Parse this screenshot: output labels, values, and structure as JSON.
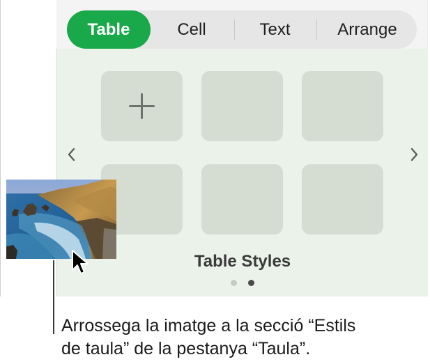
{
  "tabs": [
    {
      "label": "Table",
      "active": true
    },
    {
      "label": "Cell",
      "active": false
    },
    {
      "label": "Text",
      "active": false
    },
    {
      "label": "Arrange",
      "active": false
    }
  ],
  "colors": {
    "accent": "#19a84a",
    "inspector_bg": "#ebf2e9",
    "tile": "#d5ddd3"
  },
  "table_styles": {
    "label": "Table Styles",
    "add_tile_icon": "plus-icon",
    "tile_count": 6,
    "page_count": 2,
    "current_page": 2
  },
  "icons": {
    "prev": "chevron-left-icon",
    "next": "chevron-right-icon",
    "cursor": "arrow-pointer-icon"
  },
  "caption": {
    "line1": "Arrossega la imatge a la secció “Estils",
    "line2": "de taula” de la pestanya “Taula”."
  }
}
